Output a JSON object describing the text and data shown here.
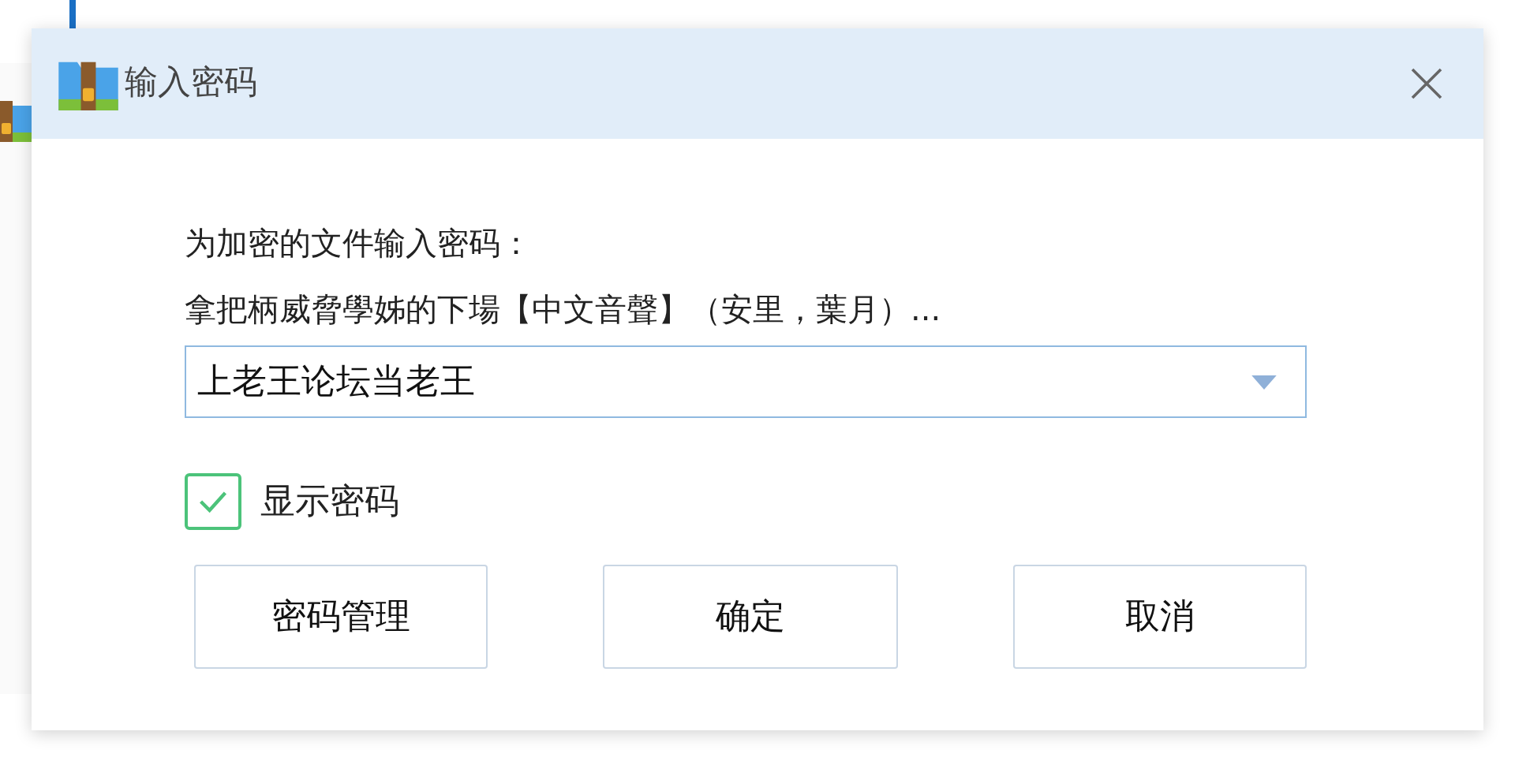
{
  "dialog": {
    "title": "输入密码",
    "prompt": "为加密的文件输入密码：",
    "file_name": "拿把柄威脅學姊的下場【中文音聲】（安里，葉月）...",
    "password": {
      "value": "上老王论坛当老王"
    },
    "show_password": {
      "label": "显示密码",
      "checked": true
    },
    "buttons": [
      {
        "label": "密码管理"
      },
      {
        "label": "确定"
      },
      {
        "label": "取消"
      }
    ]
  }
}
